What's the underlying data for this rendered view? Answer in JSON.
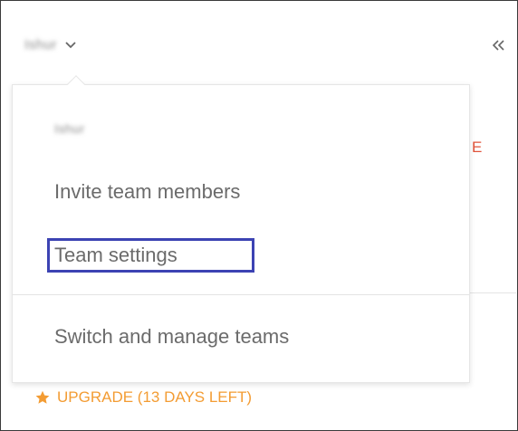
{
  "header": {
    "team_name": "Ishur",
    "collapse_glyph": "«"
  },
  "dropdown": {
    "header": "Ishur",
    "items": [
      {
        "label": "Invite team members"
      },
      {
        "label": "Team settings",
        "highlighted": true
      },
      {
        "label": "Switch and manage teams"
      }
    ]
  },
  "background": {
    "partial_text": "E"
  },
  "upgrade": {
    "label": "UPGRADE (13 DAYS LEFT)",
    "icon": "star-icon"
  },
  "colors": {
    "upgrade": "#f39c33",
    "highlight": "#3c43b3",
    "accent_red": "#e0533a",
    "menu_text": "#6b6b6b"
  }
}
